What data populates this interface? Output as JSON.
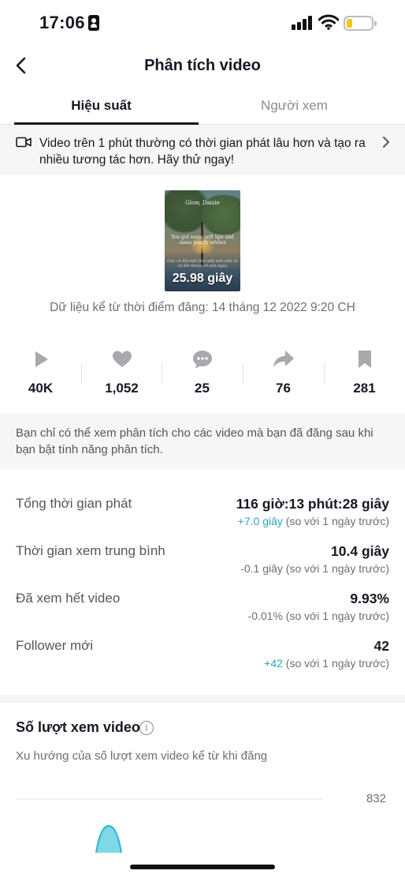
{
  "status_bar": {
    "time": "17:06"
  },
  "nav": {
    "title": "Phân tích video"
  },
  "tabs": [
    {
      "label": "Hiệu suất",
      "active": true
    },
    {
      "label": "Người xem",
      "active": false
    }
  ],
  "banner": {
    "text": "Video trên 1 phút thường có thời gian phát lâu hơn và tạo ra nhiều tương tác hơn. Hãy thử ngay!"
  },
  "video": {
    "thumb_brand": "Glow, Daisie",
    "thumb_line1": "You got some soft lips and some pearly whites",
    "thumb_line2": "Cho cả đời mãi thôi mãi mãi nữa và cả đời thuộc về anh ngay",
    "duration": "25.98 giây",
    "posted_at": "Dữ liệu kể từ thời điểm đăng: 14 tháng 12 2022 9:20 CH"
  },
  "stats": {
    "plays": "40K",
    "likes": "1,052",
    "comments": "25",
    "shares": "76",
    "saves": "281"
  },
  "notice": {
    "text": "Bạn chỉ có thể xem phân tích cho các video mà bạn đã đăng sau khi bạn bật tính năng phân tích."
  },
  "metrics": [
    {
      "label": "Tổng thời gian phát",
      "value": "116 giờ:13 phút:28 giây",
      "delta": "+7.0 giây",
      "compare": " (so với 1 ngày trước)",
      "positive": true
    },
    {
      "label": "Thời gian xem trung bình",
      "value": "10.4 giây",
      "delta": "-0.1 giây",
      "compare": " (so với 1 ngày trước)",
      "positive": false
    },
    {
      "label": "Đã xem hết video",
      "value": "9.93%",
      "delta": "-0.01%",
      "compare": " (so với 1 ngày trước)",
      "positive": false
    },
    {
      "label": "Follower mới",
      "value": "42",
      "delta": "+42",
      "compare": " (so với 1 ngày trước)",
      "positive": true
    }
  ],
  "views_section": {
    "title": "Số lượt xem video",
    "subtitle": "Xu hướng của số lượt xem video kể từ khi đăng",
    "y_max_label": "832"
  },
  "colors": {
    "accent": "#2aa6b8",
    "chart_fill": "#7fd8e6",
    "chart_line": "#2bb8cf"
  }
}
